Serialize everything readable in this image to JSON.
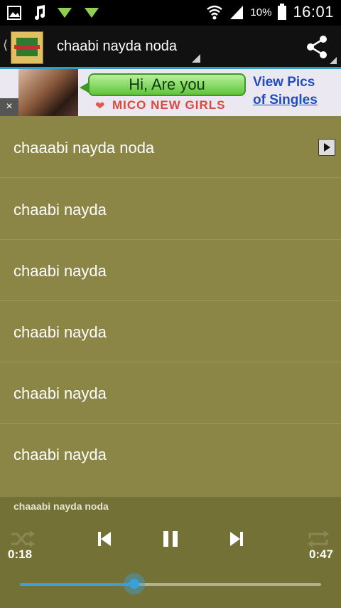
{
  "status_bar": {
    "time": "16:01",
    "battery_percent": "10%",
    "icons": [
      "gallery-icon",
      "music-note-icon",
      "download-icon",
      "download-icon",
      "wifi-icon",
      "signal-icon",
      "battery-icon"
    ]
  },
  "action_bar": {
    "title": "chaabi nayda noda",
    "icons": [
      "back-chevron-icon",
      "app-icon",
      "share-icon"
    ]
  },
  "ad": {
    "bubble_text": "Hi, Are you",
    "brand_text": "MICO NEW GIRLS",
    "right_line1": "View Pics",
    "right_line2": "of Singles",
    "close_label": "×"
  },
  "tracks": [
    {
      "label": "chaaabi nayda noda",
      "playing": true
    },
    {
      "label": "chaabi nayda"
    },
    {
      "label": "chaabi nayda"
    },
    {
      "label": "chaabi nayda"
    },
    {
      "label": "chaabi nayda"
    },
    {
      "label": "chaabi nayda"
    }
  ],
  "player": {
    "now_playing": "chaaabi nayda noda",
    "current_time": "0:18",
    "total_time": "0:47",
    "progress": 0.38,
    "controls": [
      "shuffle-icon",
      "previous-icon",
      "pause-icon",
      "next-icon",
      "repeat-icon"
    ]
  },
  "colors": {
    "list_background": "#8c8646",
    "player_background": "#747137",
    "accent": "#3aa0d8"
  }
}
